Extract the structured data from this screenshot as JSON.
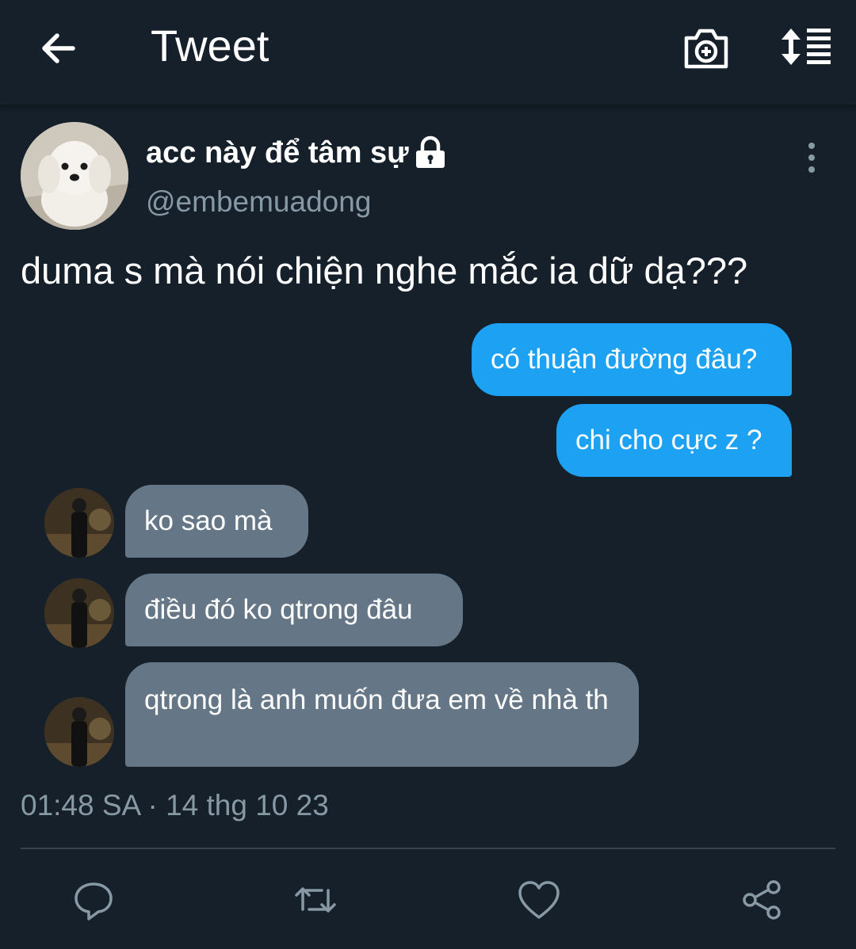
{
  "header": {
    "title": "Tweet",
    "back_icon": "arrow-left-icon",
    "camera_icon": "camera-add-icon",
    "sort_icon": "sort-list-icon"
  },
  "author": {
    "name": "acc này để tâm sự",
    "handle": "@embemuadong",
    "protected_icon": "lock-icon",
    "more_icon": "more-vertical-icon"
  },
  "tweet": {
    "text": "duma s mà nói chiện nghe mắc ia dữ dạ???"
  },
  "messages": [
    {
      "side": "sent",
      "text": "có thuận đường đâu?"
    },
    {
      "side": "sent",
      "text": "chi cho cực z ?"
    },
    {
      "side": "received",
      "text": "ko sao mà"
    },
    {
      "side": "received",
      "text": "điều đó ko qtrong đâu"
    },
    {
      "side": "received",
      "text": "qtrong là anh muốn đưa em về nhà th"
    }
  ],
  "meta": {
    "timestamp": "01:48 SA · 14 thg 10 23"
  },
  "actions": [
    "reply-icon",
    "retweet-icon",
    "like-icon",
    "share-icon"
  ],
  "colors": {
    "background": "#15202b",
    "sent_bubble": "#1da1f2",
    "received_bubble": "#657786",
    "secondary_text": "#8899a6",
    "divider": "#38444d"
  }
}
